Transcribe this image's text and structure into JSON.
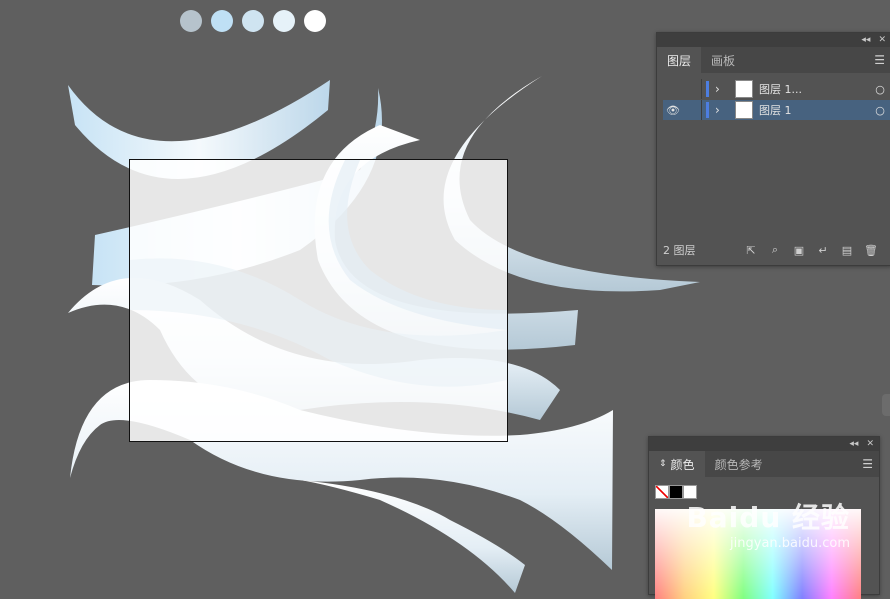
{
  "palette": {
    "swatches": [
      "#b6c3cc",
      "#bfe0f5",
      "#cfe4f1",
      "#e6f2f9",
      "#ffffff"
    ]
  },
  "layers_panel": {
    "tabs": [
      {
        "label": "图层",
        "active": true
      },
      {
        "label": "画板",
        "active": false
      }
    ],
    "layers": [
      {
        "name": "图层 1...",
        "visible": false,
        "selected": false
      },
      {
        "name": "图层 1",
        "visible": true,
        "selected": true
      }
    ],
    "footer_count": "2 图层"
  },
  "color_panel": {
    "tabs": [
      {
        "label": "颜色",
        "active": true
      },
      {
        "label": "颜色参考",
        "active": false
      }
    ]
  },
  "watermark": {
    "main": "Baidu 经验",
    "sub": "jingyan.baidu.com"
  }
}
